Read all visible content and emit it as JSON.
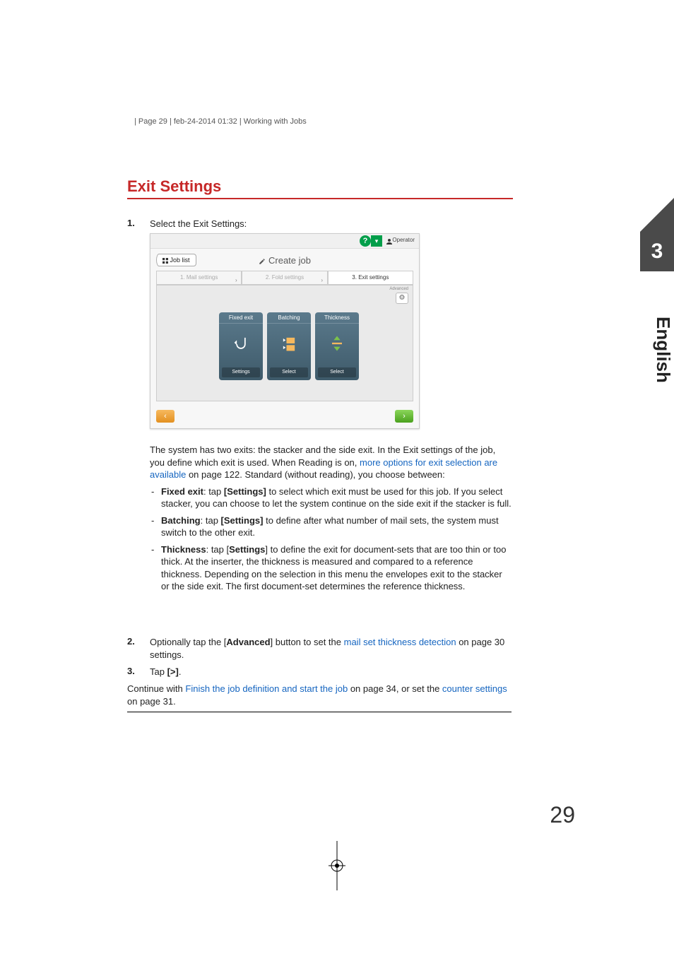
{
  "header": {
    "line": "| Page 29 | feb-24-2014 01:32 | Working with Jobs"
  },
  "title": "Exit Settings",
  "side": {
    "chapter": "3",
    "language": "English"
  },
  "page_number": "29",
  "steps": {
    "s1": {
      "num": "1.",
      "text": "Select the Exit Settings:"
    },
    "s2": {
      "num": "2.",
      "pre": "Optionally tap the [",
      "bold": "Advanced",
      "mid": "] button to set the ",
      "link": "mail set thickness detection",
      "post": " on page 30 settings."
    },
    "s3": {
      "num": "3.",
      "pre": "Tap ",
      "bold": "[>]",
      "post": "."
    }
  },
  "screenshot": {
    "help_icon": "?",
    "dropdown_glyph": "▾",
    "operator": "Operator",
    "joblist": "Job list",
    "title": "Create job",
    "tabs": {
      "t1": "1. Mail settings",
      "t2": "2. Fold settings",
      "t3": "3. Exit settings"
    },
    "advanced_label": "Advanced",
    "gear_glyph": "⚙",
    "cards": {
      "c1": {
        "title": "Fixed exit",
        "button": "Settings"
      },
      "c2": {
        "title": "Batching",
        "button": "Select"
      },
      "c3": {
        "title": "Thickness",
        "button": "Select"
      }
    },
    "prev": "‹",
    "next": "›"
  },
  "intro": {
    "pre": "The system has two exits: the stacker and the side exit. In the Exit settings of the job, you define which exit is used. When Reading is on, ",
    "link": "more options for exit selection are available",
    "post": " on page 122. Standard (without reading), you choose between:"
  },
  "bullets": {
    "b1": {
      "bold": "Fixed exit",
      "mid": ": tap ",
      "bold2": "[Settings]",
      "rest": " to select which exit must be used for this job. If you select stacker, you can choose to let the system continue on the side exit if the stacker is full."
    },
    "b2": {
      "bold": "Batching",
      "mid": ": tap ",
      "bold2": "[Settings]",
      "rest": " to define after what number of mail sets, the system must switch to the other exit."
    },
    "b3": {
      "bold": "Thickness",
      "mid": ": tap [",
      "bold2": "Settings",
      "rest": "] to define the exit for document-sets that are too thin or too thick. At the inserter, the thickness is measured and compared to a reference thickness. Depending on the selection in this menu the envelopes exit to the stacker or the side exit. The first document-set determines the reference thickness."
    }
  },
  "closing": {
    "pre": "Continue with ",
    "link1": "Finish the job definition and start the job",
    "mid": " on page 34, or set the ",
    "link2": "counter settings",
    "post": " on page 31."
  }
}
